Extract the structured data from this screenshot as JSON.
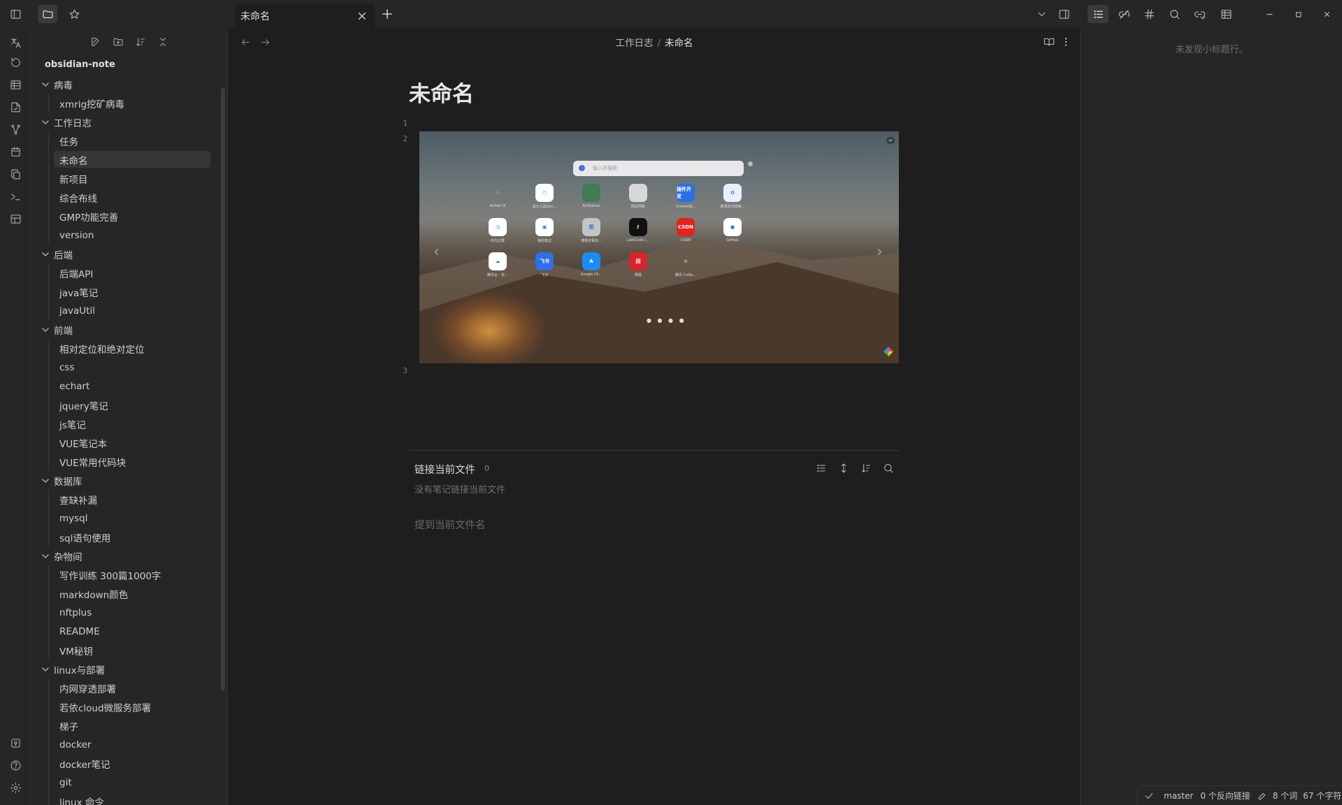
{
  "tab": {
    "title": "未命名"
  },
  "explorer": {
    "vault_name": "obsidian-note",
    "tree": [
      {
        "type": "folder",
        "label": "病毒"
      },
      {
        "type": "file",
        "label": "xmrig挖矿病毒"
      },
      {
        "type": "folder",
        "label": "工作日志"
      },
      {
        "type": "file",
        "label": "任务"
      },
      {
        "type": "file",
        "label": "未命名",
        "selected": true
      },
      {
        "type": "file",
        "label": "新项目"
      },
      {
        "type": "file",
        "label": "综合布线"
      },
      {
        "type": "file",
        "label": "GMP功能完善"
      },
      {
        "type": "file",
        "label": "version"
      },
      {
        "type": "folder",
        "label": "后端"
      },
      {
        "type": "file",
        "label": "后端API"
      },
      {
        "type": "file",
        "label": "java笔记"
      },
      {
        "type": "file",
        "label": "javaUtil"
      },
      {
        "type": "folder",
        "label": "前端"
      },
      {
        "type": "file",
        "label": "相对定位和绝对定位"
      },
      {
        "type": "file",
        "label": "css"
      },
      {
        "type": "file",
        "label": "echart"
      },
      {
        "type": "file",
        "label": "jquery笔记"
      },
      {
        "type": "file",
        "label": "js笔记"
      },
      {
        "type": "file",
        "label": "VUE笔记本"
      },
      {
        "type": "file",
        "label": "VUE常用代码块"
      },
      {
        "type": "folder",
        "label": "数据库"
      },
      {
        "type": "file",
        "label": "查缺补漏"
      },
      {
        "type": "file",
        "label": "mysql"
      },
      {
        "type": "file",
        "label": "sql语句使用"
      },
      {
        "type": "folder",
        "label": "杂物间"
      },
      {
        "type": "file",
        "label": "写作训练 300篇1000字"
      },
      {
        "type": "file",
        "label": "markdown颜色"
      },
      {
        "type": "file",
        "label": "nftplus"
      },
      {
        "type": "file",
        "label": "README"
      },
      {
        "type": "file",
        "label": "VM秘钥"
      },
      {
        "type": "folder",
        "label": "linux与部署"
      },
      {
        "type": "file",
        "label": "内网穿透部署"
      },
      {
        "type": "file",
        "label": "若依cloud微服务部署"
      },
      {
        "type": "file",
        "label": "梯子"
      },
      {
        "type": "file",
        "label": "docker"
      },
      {
        "type": "file",
        "label": "docker笔记"
      },
      {
        "type": "file",
        "label": "git"
      },
      {
        "type": "file",
        "label": "linux 命令"
      }
    ]
  },
  "editor": {
    "breadcrumb_folder": "工作日志",
    "breadcrumb_sep": "/",
    "breadcrumb_file": "未命名",
    "title": "未命名",
    "line_numbers": [
      "1",
      "2",
      "3"
    ],
    "embed": {
      "search_placeholder": "输入开搜索",
      "apps": [
        {
          "label": "ArtNet UI",
          "color": "#00000000",
          "glyph": "☼"
        },
        {
          "label": "设计工具(Sm...",
          "color": "#ffffff",
          "glyph": "⬡"
        },
        {
          "label": "ArtStation",
          "color": "#3f7b56",
          "glyph": ""
        },
        {
          "label": "网站导航",
          "color": "#d8d8dc",
          "glyph": ""
        },
        {
          "label": "chrome拓...",
          "color": "#2b6fe5",
          "glyph": "插件开发"
        },
        {
          "label": "新闻资讯搜索...",
          "color": "#e9f0fb",
          "glyph": "✿"
        },
        {
          "label": "时光记录",
          "color": "#ffffff",
          "glyph": "◷"
        },
        {
          "label": "我的笔记",
          "color": "#ffffff",
          "glyph": "▣"
        },
        {
          "label": "滴答记事本...",
          "color": "#c4c4c4",
          "glyph": "图"
        },
        {
          "label": "LeetCode (...",
          "color": "#111111",
          "glyph": "ℓ"
        },
        {
          "label": "CSDN",
          "color": "#e0231e",
          "glyph": "CSDN"
        },
        {
          "label": "GitHub",
          "color": "#ffffff",
          "glyph": "●"
        },
        {
          "label": "腾讯云 - 折...",
          "color": "#ffffff",
          "glyph": "☁"
        },
        {
          "label": "飞书",
          "color": "#2f6fe8",
          "glyph": "飞书"
        },
        {
          "label": "Google Ch...",
          "color": "#1d8cf0",
          "glyph": "A"
        },
        {
          "label": "网易",
          "color": "#d7262b",
          "glyph": "回"
        },
        {
          "label": "腾讯 CoDe...",
          "color": "#00000000",
          "glyph": "≡"
        }
      ]
    },
    "backlinks": {
      "title": "链接当前文件",
      "count": "0",
      "empty": "没有笔记链接当前文件",
      "unlinked": "提到当前文件名"
    }
  },
  "outline": {
    "empty": "未发现小标题行。"
  },
  "status": {
    "branch": "master",
    "backlinks": "0 个反向链接",
    "words": "8 个词",
    "chars": "67 个字符"
  }
}
